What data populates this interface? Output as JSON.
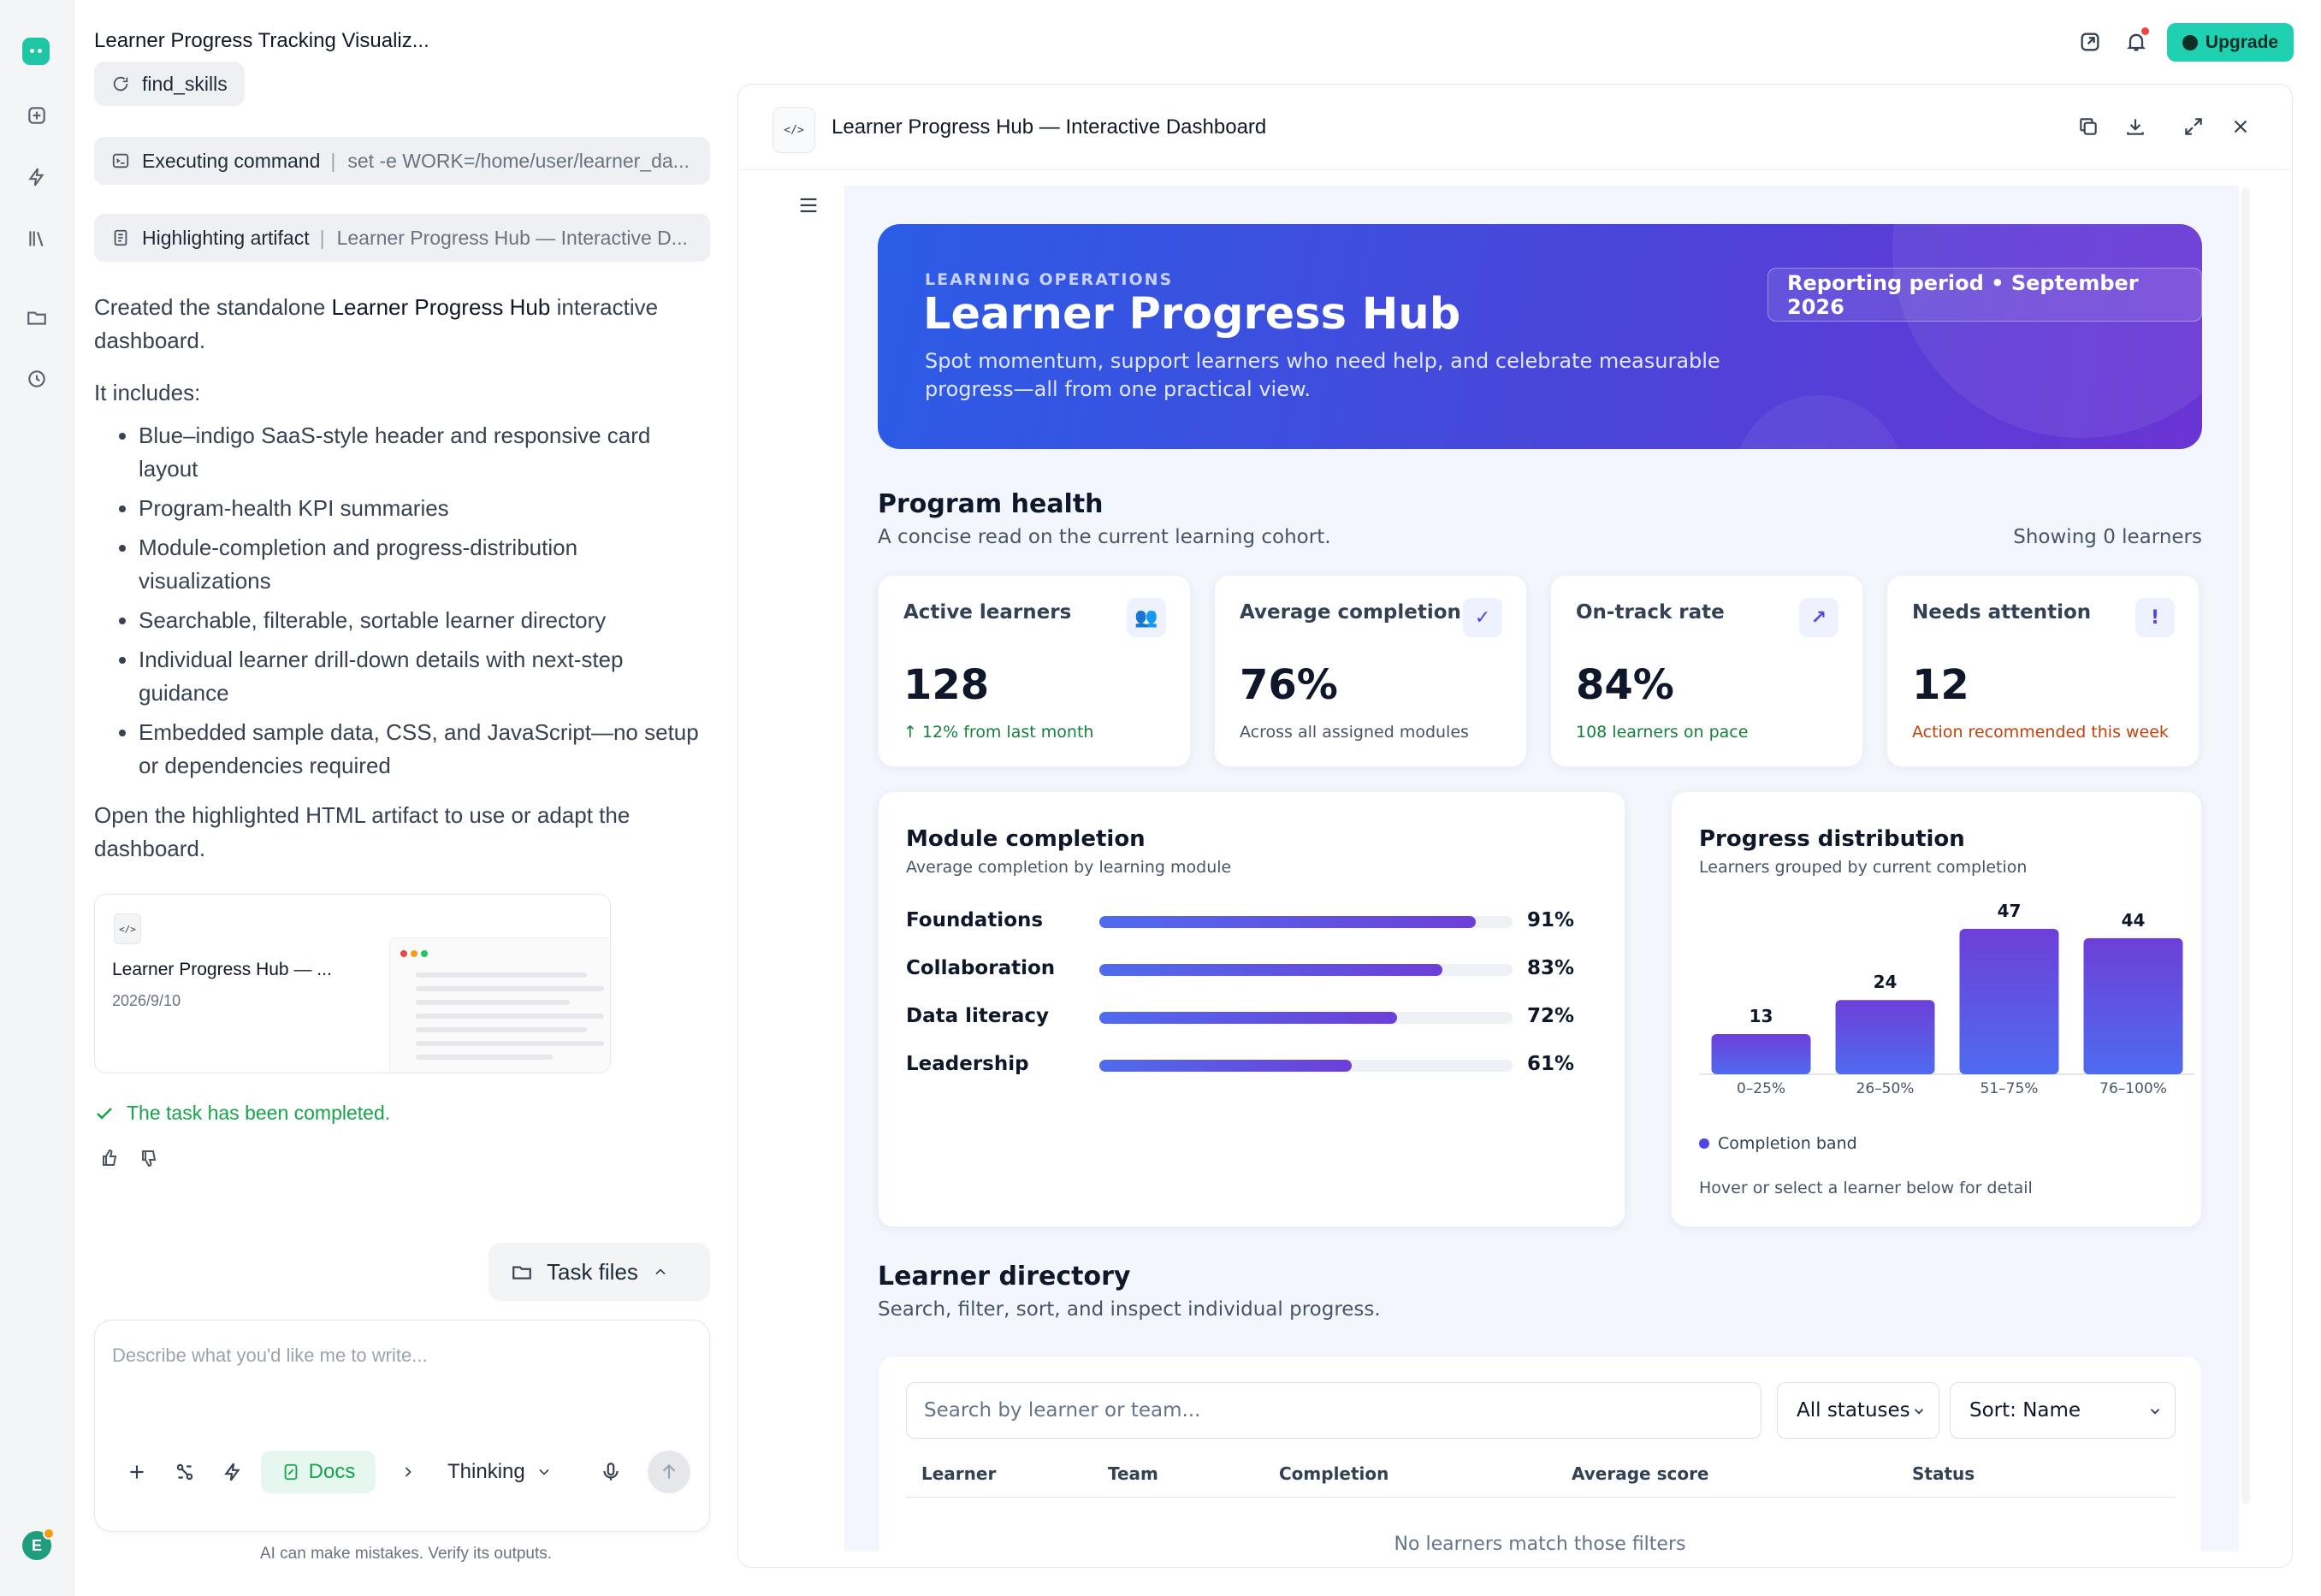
{
  "app": {
    "title": "Learner Progress Tracking Visualiz...",
    "upgrade_label": "Upgrade"
  },
  "chat": {
    "steps": [
      {
        "label": "find_skills",
        "detail": ""
      },
      {
        "label": "Executing command",
        "detail": "set -e WORK=/home/user/learner_da..."
      },
      {
        "label": "Highlighting artifact",
        "detail": "Learner Progress Hub — Interactive D..."
      }
    ],
    "intro_pre": "Created the standalone ",
    "intro_bold": "Learner Progress Hub",
    "intro_post": " interactive dashboard.",
    "includes_label": "It includes:",
    "bullets": [
      "Blue–indigo SaaS-style header and responsive card layout",
      "Program-health KPI summaries",
      "Module-completion and progress-distribution visualizations",
      "Searchable, filterable, sortable learner directory",
      "Individual learner drill-down details with next-step guidance",
      "Embedded sample data, CSS, and JavaScript—no setup or dependencies required"
    ],
    "outro": "Open the highlighted HTML artifact to use or adapt the dashboard.",
    "artifact_card": {
      "title": "Learner Progress Hub — ...",
      "date": "2026/9/10",
      "icon": "</>"
    },
    "status": "The task has been completed.",
    "task_files_label": "Task files",
    "composer_placeholder": "Describe what you'd like me to write...",
    "docs_label": "Docs",
    "thinking_label": "Thinking",
    "disclaimer": "AI can make mistakes. Verify its outputs."
  },
  "panel": {
    "title": "Learner Progress Hub — Interactive Dashboard",
    "file_icon": "</>"
  },
  "dashboard": {
    "hero": {
      "eyebrow": "LEARNING OPERATIONS",
      "title": "Learner Progress Hub",
      "subtitle": "Spot momentum, support learners who need help, and celebrate measurable progress—all from one practical view.",
      "period": "Reporting period • September 2026"
    },
    "health": {
      "title": "Program health",
      "subtitle": "A concise read on the current learning cohort.",
      "showing": "Showing 0 learners"
    },
    "kpis": [
      {
        "label": "Active learners",
        "value": "128",
        "note": "↑ 12% from last month",
        "icon": "people-icon",
        "glyph": "👥",
        "note_color": "#15803d"
      },
      {
        "label": "Average completion",
        "value": "76%",
        "note": "Across all assigned modules",
        "icon": "check-icon",
        "glyph": "✓",
        "note_color": "#475569"
      },
      {
        "label": "On-track rate",
        "value": "84%",
        "note": "108 learners on pace",
        "icon": "trend-up-icon",
        "glyph": "↗",
        "note_color": "#15803d"
      },
      {
        "label": "Needs attention",
        "value": "12",
        "note": "Action recommended this week",
        "icon": "alert-icon",
        "glyph": "!",
        "note_color": "#c2410c"
      }
    ],
    "modules": {
      "title": "Module completion",
      "subtitle": "Average completion by learning module",
      "rows": [
        {
          "name": "Foundations",
          "value": 91,
          "label": "91%"
        },
        {
          "name": "Collaboration",
          "value": 83,
          "label": "83%"
        },
        {
          "name": "Data literacy",
          "value": 72,
          "label": "72%"
        },
        {
          "name": "Leadership",
          "value": 61,
          "label": "61%"
        }
      ]
    },
    "distribution": {
      "title": "Progress distribution",
      "subtitle": "Learners grouped by current completion",
      "legend": "Completion band",
      "hint": "Hover or select a learner below for detail"
    },
    "directory": {
      "title": "Learner directory",
      "subtitle": "Search, filter, sort, and inspect individual progress.",
      "search_placeholder": "Search by learner or team...",
      "status_filter": "All statuses",
      "sort": "Sort: Name",
      "columns": [
        "Learner",
        "Team",
        "Completion",
        "Average score",
        "Status"
      ],
      "empty": "No learners match those filters"
    }
  },
  "chart_data": {
    "type": "bar",
    "categories": [
      "0–25%",
      "26–50%",
      "51–75%",
      "76–100%"
    ],
    "values": [
      13,
      24,
      47,
      44
    ],
    "title": "Progress distribution",
    "xlabel": "",
    "ylabel": "",
    "ylim": [
      0,
      47
    ],
    "series": [
      {
        "name": "Completion band",
        "values": [
          13,
          24,
          47,
          44
        ]
      }
    ],
    "grid": false,
    "legend": "bottom-left"
  },
  "colors": {
    "accent": "#1fd1b0",
    "hero_start": "#2b5ce6",
    "hero_end": "#6a34d4",
    "bar": "#4f46e5",
    "success": "#16a34a"
  }
}
